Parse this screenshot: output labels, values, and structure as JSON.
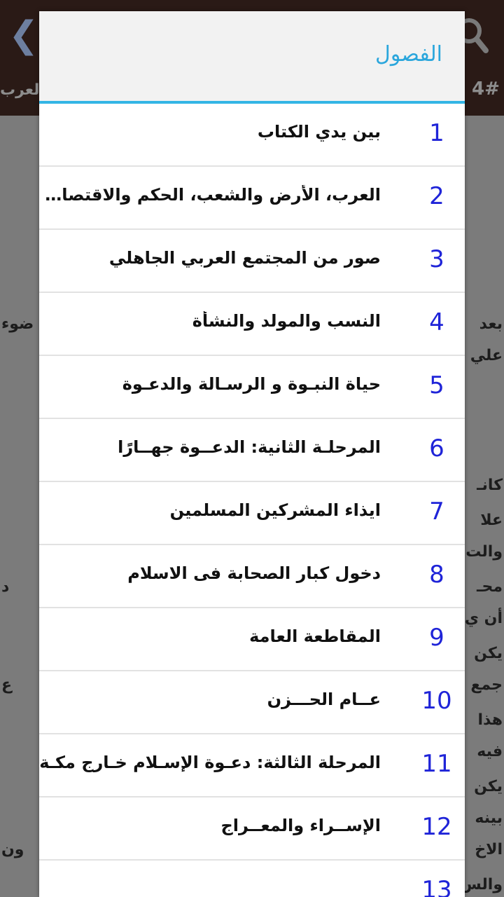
{
  "background": {
    "badge": "4#",
    "title_fragment": "العرب",
    "text_lines": [
      {
        "right": "بعد",
        "left": "ضوء"
      },
      {
        "right": "علي",
        "left": ""
      },
      {
        "right": "كانـ",
        "left": ""
      },
      {
        "right": "علا",
        "left": ""
      },
      {
        "right": "والت",
        "left": ""
      },
      {
        "right": "محـ",
        "left": "د"
      },
      {
        "right": "أن ي",
        "left": ""
      },
      {
        "right": "يكن",
        "left": ""
      },
      {
        "right": "جمع",
        "left": "ع"
      },
      {
        "right": "هذا",
        "left": ""
      },
      {
        "right": "فيه",
        "left": ""
      },
      {
        "right": "يكن",
        "left": ""
      },
      {
        "right": "بينه",
        "left": ""
      },
      {
        "right": "الاخ",
        "left": "ون"
      },
      {
        "right": "والس",
        "left": ""
      }
    ]
  },
  "dialog": {
    "title": "الفصول",
    "chapters": [
      {
        "number": "1",
        "title": "بين يدي الكتاب"
      },
      {
        "number": "2",
        "title": "العرب، الأرض والشعب، الحكم والاقتصاد، الديانة"
      },
      {
        "number": "3",
        "title": "صور من المجتمع العربي الجاهلي"
      },
      {
        "number": "4",
        "title": "النسب والمولد والنشأة"
      },
      {
        "number": "5",
        "title": "حياة النبـوة و الرسـالة والدعـوة"
      },
      {
        "number": "6",
        "title": "المرحلـة الثانية: الدعــوة جهــارًا"
      },
      {
        "number": "7",
        "title": "ايذاء المشركين المسلمين"
      },
      {
        "number": "8",
        "title": "دخول كبار الصحابة فى الاسلام"
      },
      {
        "number": "9",
        "title": "المقاطعة العامة"
      },
      {
        "number": "10",
        "title": "عــام الحـــزن"
      },
      {
        "number": "11",
        "title": "المرحلة الثالثة: دعـوة الإسـلام خـارج مكـة"
      },
      {
        "number": "12",
        "title": "الإســراء والمعــراج"
      },
      {
        "number": "13",
        "title": ""
      }
    ]
  },
  "colors": {
    "accent": "#33b5e5",
    "number": "#1f24d8",
    "appbar": "#2a1a16"
  },
  "icons": [
    "back-chevron-icon",
    "search-icon"
  ]
}
